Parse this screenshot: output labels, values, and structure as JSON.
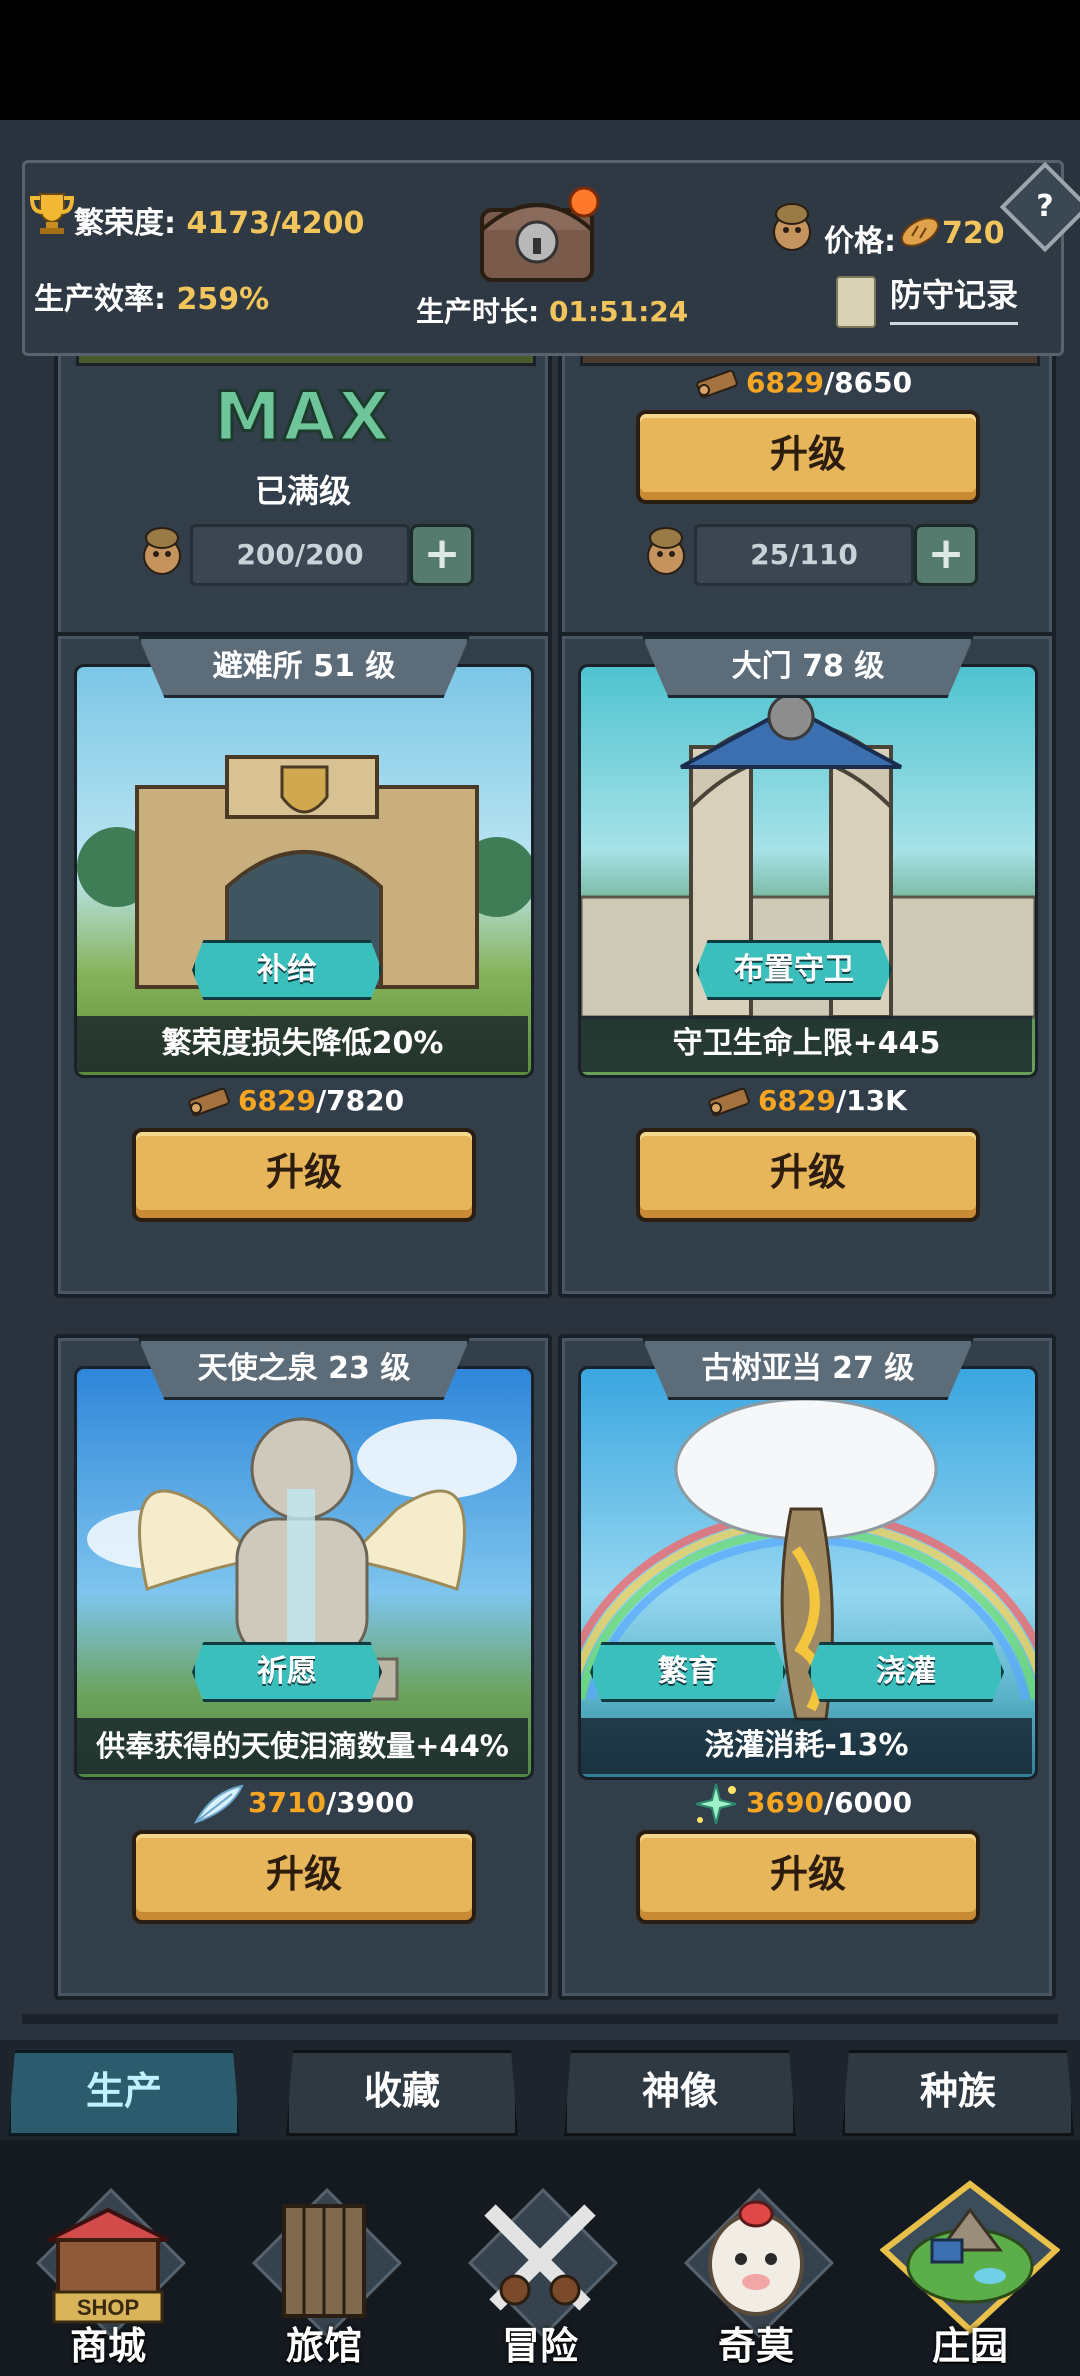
{
  "header": {
    "prosperity_label": "繁荣度:",
    "prosperity_value": "4173/4200",
    "efficiency_label": "生产效率:",
    "efficiency_value": "259%",
    "duration_label": "生产时长:",
    "duration_value": "01:51:24",
    "price_label": "价格:",
    "price_value": "720",
    "defense_record": "防守记录",
    "help": "?"
  },
  "top_cards": [
    {
      "max_text": "MAX",
      "maxed_label": "已满级",
      "workers": "200/200"
    },
    {
      "cost_have": "6829",
      "cost_need": "/8650",
      "upgrade": "升级",
      "workers": "25/110"
    }
  ],
  "buildings": [
    {
      "name": "避难所",
      "level": "51 级",
      "action": "补给",
      "effect": "繁荣度损失降低20%",
      "cost_have": "6829",
      "cost_need": "/7820",
      "upgrade": "升级"
    },
    {
      "name": "大门",
      "level": "78 级",
      "action": "布置守卫",
      "effect": "守卫生命上限+445",
      "cost_have": "6829",
      "cost_need": "/13K",
      "upgrade": "升级"
    },
    {
      "name": "天使之泉",
      "level": "23 级",
      "action": "祈愿",
      "effect": "供奉获得的天使泪滴数量+44%",
      "cost_have": "3710",
      "cost_need": "/3900",
      "upgrade": "升级"
    },
    {
      "name": "古树亚当",
      "level": "27 级",
      "action": "繁育",
      "action2": "浇灌",
      "effect": "浇灌消耗-13%",
      "cost_have": "3690",
      "cost_need": "/6000",
      "upgrade": "升级"
    }
  ],
  "tabs": [
    "生产",
    "收藏",
    "神像",
    "种族"
  ],
  "nav": [
    "商城",
    "旅馆",
    "冒险",
    "奇莫",
    "庄园"
  ],
  "shop_sign": "SHOP",
  "colors": {
    "gold": "#e8b65a",
    "teal": "#3bbfbd",
    "panel": "#323e4a",
    "cost": "#f6a623"
  }
}
